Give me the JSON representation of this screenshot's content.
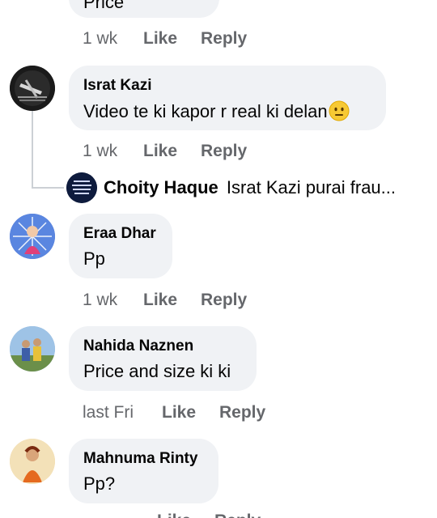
{
  "comments": [
    {
      "text_partial": "Price",
      "time": "1 wk",
      "like": "Like",
      "reply": "Reply"
    },
    {
      "author": "Israt Kazi",
      "text": "Video te ki kapor r real ki delan",
      "emoji_icon": "neutral-face-icon",
      "time": "1 wk",
      "like": "Like",
      "reply": "Reply",
      "reply_preview": {
        "author": "Choity Haque",
        "text": "Israt Kazi purai frau..."
      }
    },
    {
      "author": "Eraa Dhar",
      "text": "Pp",
      "time": "1 wk",
      "like": "Like",
      "reply": "Reply"
    },
    {
      "author": "Nahida Naznen",
      "text": "Price and size ki ki",
      "time": "last Fri",
      "like": "Like",
      "reply": "Reply"
    },
    {
      "author": "Mahnuma Rinty",
      "text": "Pp?",
      "time": "",
      "like": "Like",
      "reply": "Reply"
    }
  ],
  "colors": {
    "bubble": "#f0f2f5",
    "meta": "#65676b",
    "text": "#050505",
    "thread_line": "#ccd0d5"
  }
}
